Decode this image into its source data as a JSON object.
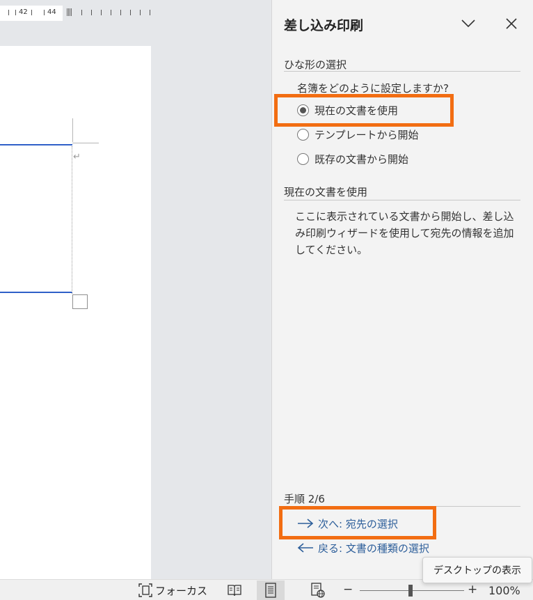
{
  "ruler": {
    "marks": [
      "42",
      "44"
    ]
  },
  "task_pane": {
    "title": "差し込み印刷",
    "collapse_icon": "chevron-down-icon",
    "close_icon": "close-icon",
    "template_section": {
      "heading": "ひな形の選択",
      "question": "名簿をどのように設定しますか?",
      "options": [
        {
          "label": "現在の文書を使用",
          "selected": true
        },
        {
          "label": "テンプレートから開始",
          "selected": false
        },
        {
          "label": "既存の文書から開始",
          "selected": false
        }
      ]
    },
    "description_section": {
      "heading": "現在の文書を使用",
      "text": "ここに表示されている文書から開始し、差し込み印刷ウィザードを使用して宛先の情報を追加してください。"
    },
    "step": "手順 2/6",
    "next_link": "次へ: 宛先の選択",
    "back_link": "戻る: 文書の種類の選択",
    "highlight_color": "#f26d12",
    "link_color": "#2c5e9a"
  },
  "statusbar": {
    "focus_label": "フォーカス",
    "zoom_minus": "−",
    "zoom_plus": "+",
    "zoom_level": "100%"
  },
  "tooltip": "デスクトップの表示"
}
